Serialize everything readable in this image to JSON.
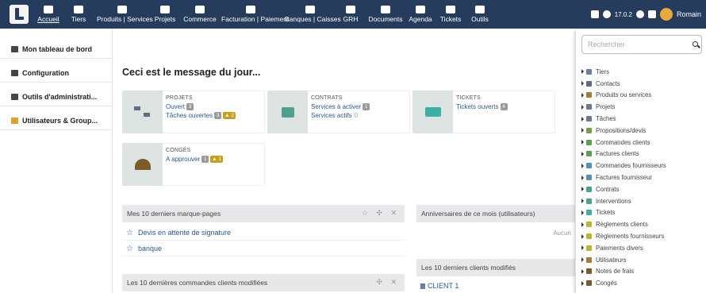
{
  "topbar": {
    "menu": [
      {
        "label": "Accueil",
        "icon": "home-icon"
      },
      {
        "label": "Tiers",
        "icon": "building-icon"
      },
      {
        "label": "Produits | Services",
        "icon": "cube-icon"
      },
      {
        "label": "Projets",
        "icon": "sitemap-icon"
      },
      {
        "label": "Commerce",
        "icon": "briefcase-icon"
      },
      {
        "label": "Facturation | Paiement",
        "icon": "invoice-icon"
      },
      {
        "label": "Banques | Caisses",
        "icon": "bank-icon"
      },
      {
        "label": "GRH",
        "icon": "user-icon"
      },
      {
        "label": "Documents",
        "icon": "folder-icon"
      },
      {
        "label": "Agenda",
        "icon": "calendar-icon"
      },
      {
        "label": "Tickets",
        "icon": "ticket-icon"
      },
      {
        "label": "Outils",
        "icon": "wrench-icon"
      }
    ],
    "version": "17.0.2",
    "user": "Romain"
  },
  "sidebar": {
    "items": [
      {
        "label": "Mon tableau de bord",
        "icon": "chart-line-icon"
      },
      {
        "label": "Configuration",
        "icon": "tools-icon"
      },
      {
        "label": "Outils d'administrati...",
        "icon": "server-icon"
      },
      {
        "label": "Utilisateurs & Group...",
        "icon": "user-icon"
      }
    ]
  },
  "main": {
    "motd": "Ceci est le message du jour...",
    "cards": {
      "projets": {
        "title": "PROJETS",
        "line1": "Ouvert",
        "line1_badge": "3",
        "line2": "Tâches ouvertes",
        "line2_badge": "3",
        "line2_warn": "2"
      },
      "contrats": {
        "title": "CONTRATS",
        "line1": "Services à activer",
        "line1_badge": "1",
        "line2": "Services actifs",
        "line2_num": "0"
      },
      "tickets": {
        "title": "TICKETS",
        "line1": "Tickets ouverts",
        "line1_badge": "4"
      },
      "conges": {
        "title": "CONGÉS",
        "line1": "A approuver",
        "line1_badge": "1",
        "line1_warn": "1"
      }
    },
    "bookmarks": {
      "title": "Mes 10 derniers marque-pages",
      "items": [
        "Devis en attente de signature",
        "banque"
      ]
    },
    "orders": {
      "title": "Les 10 dernières commandes clients modifiées"
    },
    "birthdays": {
      "title": "Anniversaires de ce mois (utilisateurs)",
      "empty": "Aucun"
    },
    "clients": {
      "title": "Les 10 derniers clients modifiés",
      "items": [
        "CLIENT 1"
      ]
    }
  },
  "dropdown": {
    "search_placeholder": "Rechercher",
    "items": [
      {
        "label": "Tiers",
        "color": "#6a7fa4"
      },
      {
        "label": "Contacts",
        "color": "#5e6a88"
      },
      {
        "label": "Produits ou services",
        "color": "#a07c3e"
      },
      {
        "label": "Projets",
        "color": "#6c7a89"
      },
      {
        "label": "Tâches",
        "color": "#6c7a89"
      },
      {
        "label": "Propositions/devis",
        "color": "#76a04a"
      },
      {
        "label": "Commandes clients",
        "color": "#5f9e55"
      },
      {
        "label": "Factures clients",
        "color": "#5f9e55"
      },
      {
        "label": "Commandes fournisseurs",
        "color": "#5a8fb6"
      },
      {
        "label": "Factures fournisseur",
        "color": "#5a8fb6"
      },
      {
        "label": "Contrats",
        "color": "#4fa18f"
      },
      {
        "label": "Interventions",
        "color": "#4fa18f"
      },
      {
        "label": "Tickets",
        "color": "#3eb0a3"
      },
      {
        "label": "Règlements clients",
        "color": "#b8b834"
      },
      {
        "label": "Règlements fournisseurs",
        "color": "#b8b834"
      },
      {
        "label": "Paiements divers",
        "color": "#b8b834"
      },
      {
        "label": "Utilisateurs",
        "color": "#a07c3e"
      },
      {
        "label": "Notes de frais",
        "color": "#7b5b2b"
      },
      {
        "label": "Congés",
        "color": "#7b5b2b"
      }
    ]
  }
}
